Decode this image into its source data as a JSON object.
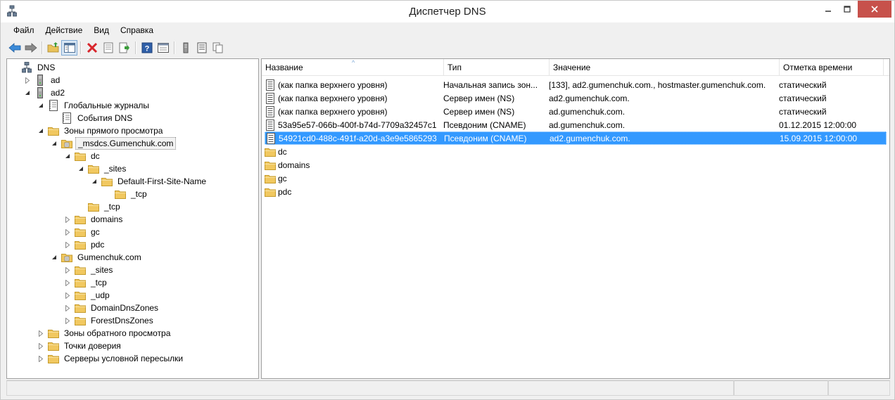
{
  "window": {
    "title": "Диспетчер DNS"
  },
  "menu": [
    {
      "label": "Файл"
    },
    {
      "label": "Действие"
    },
    {
      "label": "Вид"
    },
    {
      "label": "Справка"
    }
  ],
  "toolbar": {
    "icons": [
      "back-arrow-icon",
      "forward-arrow-icon",
      "up-folder-icon",
      "show-tree-icon",
      "delete-icon",
      "properties-icon",
      "export-icon",
      "help-icon",
      "console-icon",
      "server-icon",
      "list-icon",
      "copy-icon"
    ]
  },
  "tree": [
    {
      "label": "DNS",
      "depth": 0,
      "expander": "none",
      "icon": "dns-root"
    },
    {
      "label": "ad",
      "depth": 1,
      "expander": "collapsed",
      "icon": "server"
    },
    {
      "label": "ad2",
      "depth": 1,
      "expander": "expanded",
      "icon": "server"
    },
    {
      "label": "Глобальные журналы",
      "depth": 2,
      "expander": "expanded",
      "icon": "log"
    },
    {
      "label": "События DNS",
      "depth": 3,
      "expander": "none",
      "icon": "log"
    },
    {
      "label": "Зоны прямого просмотра",
      "depth": 2,
      "expander": "expanded",
      "icon": "folder"
    },
    {
      "label": "_msdcs.Gumenchuk.com",
      "depth": 3,
      "expander": "expanded",
      "icon": "zone",
      "selected": true
    },
    {
      "label": "dc",
      "depth": 4,
      "expander": "expanded",
      "icon": "folder"
    },
    {
      "label": "_sites",
      "depth": 5,
      "expander": "expanded",
      "icon": "folder"
    },
    {
      "label": "Default-First-Site-Name",
      "depth": 6,
      "expander": "expanded",
      "icon": "folder"
    },
    {
      "label": "_tcp",
      "depth": 7,
      "expander": "none",
      "icon": "folder"
    },
    {
      "label": "_tcp",
      "depth": 5,
      "expander": "none",
      "icon": "folder"
    },
    {
      "label": "domains",
      "depth": 4,
      "expander": "collapsed",
      "icon": "folder"
    },
    {
      "label": "gc",
      "depth": 4,
      "expander": "collapsed",
      "icon": "folder"
    },
    {
      "label": "pdc",
      "depth": 4,
      "expander": "collapsed",
      "icon": "folder"
    },
    {
      "label": "Gumenchuk.com",
      "depth": 3,
      "expander": "expanded",
      "icon": "zone"
    },
    {
      "label": "_sites",
      "depth": 4,
      "expander": "collapsed",
      "icon": "folder"
    },
    {
      "label": "_tcp",
      "depth": 4,
      "expander": "collapsed",
      "icon": "folder"
    },
    {
      "label": "_udp",
      "depth": 4,
      "expander": "collapsed",
      "icon": "folder"
    },
    {
      "label": "DomainDnsZones",
      "depth": 4,
      "expander": "collapsed",
      "icon": "folder"
    },
    {
      "label": "ForestDnsZones",
      "depth": 4,
      "expander": "collapsed",
      "icon": "folder"
    },
    {
      "label": "Зоны обратного просмотра",
      "depth": 2,
      "expander": "collapsed",
      "icon": "folder"
    },
    {
      "label": "Точки доверия",
      "depth": 2,
      "expander": "collapsed",
      "icon": "folder"
    },
    {
      "label": "Серверы условной пересылки",
      "depth": 2,
      "expander": "collapsed",
      "icon": "folder"
    }
  ],
  "list": {
    "columns": [
      {
        "label": "Название"
      },
      {
        "label": "Тип"
      },
      {
        "label": "Значение"
      },
      {
        "label": "Отметка времени"
      }
    ],
    "rows": [
      {
        "icon": "record",
        "name": "(как папка верхнего уровня)",
        "type": "Начальная запись зон...",
        "value": "[133], ad2.gumenchuk.com., hostmaster.gumenchuk.com.",
        "ts": "статический"
      },
      {
        "icon": "record",
        "name": "(как папка верхнего уровня)",
        "type": "Сервер имен (NS)",
        "value": "ad2.gumenchuk.com.",
        "ts": "статический"
      },
      {
        "icon": "record",
        "name": "(как папка верхнего уровня)",
        "type": "Сервер имен (NS)",
        "value": "ad.gumenchuk.com.",
        "ts": "статический"
      },
      {
        "icon": "record",
        "name": "53a95e57-066b-400f-b74d-7709a32457c1",
        "type": "Псевдоним (CNAME)",
        "value": "ad.gumenchuk.com.",
        "ts": "01.12.2015 12:00:00"
      },
      {
        "icon": "record",
        "name": "54921cd0-488c-491f-a20d-a3e9e5865293",
        "type": "Псевдоним (CNAME)",
        "value": "ad2.gumenchuk.com.",
        "ts": "15.09.2015 12:00:00",
        "selected": true
      },
      {
        "icon": "folder",
        "name": "dc",
        "type": "",
        "value": "",
        "ts": ""
      },
      {
        "icon": "folder",
        "name": "domains",
        "type": "",
        "value": "",
        "ts": ""
      },
      {
        "icon": "folder",
        "name": "gc",
        "type": "",
        "value": "",
        "ts": ""
      },
      {
        "icon": "folder",
        "name": "pdc",
        "type": "",
        "value": "",
        "ts": ""
      }
    ]
  },
  "colors": {
    "selection": "#3399ff",
    "close_button": "#c7514b",
    "folder": "#f1c860"
  }
}
